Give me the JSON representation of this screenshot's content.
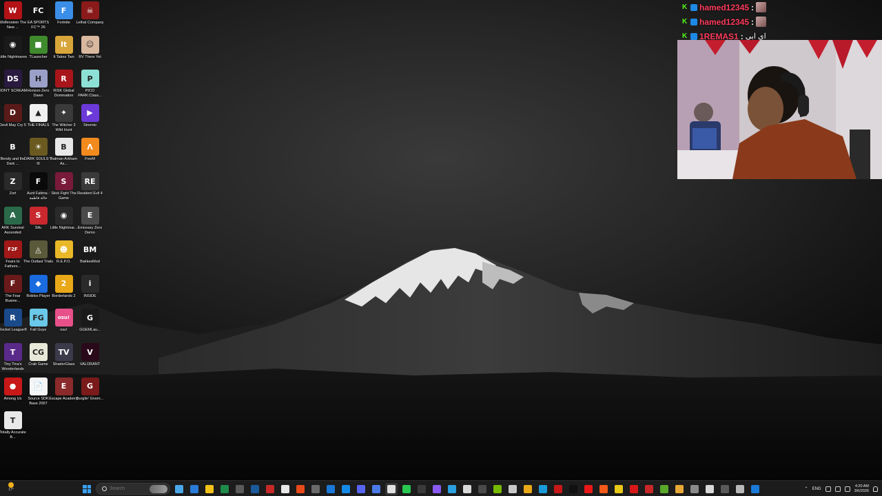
{
  "desktop": {
    "icons": [
      {
        "label": "Wolfenstein The New ...",
        "glyph": "W",
        "color": "#b31217"
      },
      {
        "label": "EA SPORTS FC™ 26",
        "glyph": "FC",
        "color": "#111111"
      },
      {
        "label": "Fortnite",
        "glyph": "F",
        "color": "#3b8ee8"
      },
      {
        "label": "Lethal Company",
        "glyph": "☠",
        "color": "#8b1a1a"
      },
      {
        "label": "Little Nightmares",
        "glyph": "◉",
        "color": "#1a1a1a"
      },
      {
        "label": "TLauncher",
        "glyph": "■",
        "color": "#3f8a2c"
      },
      {
        "label": "It Takes Two",
        "glyph": "It",
        "color": "#d8a53a"
      },
      {
        "label": "RV There Yet",
        "glyph": "☺",
        "color": "#d9b8a0"
      },
      {
        "label": "DON'T SCREAM",
        "glyph": "DS",
        "color": "#2a1a40"
      },
      {
        "label": "Horizon Zero Dawn",
        "glyph": "H",
        "color": "#9aa0c8"
      },
      {
        "label": "RISK Global Domination",
        "glyph": "R",
        "color": "#a8151a"
      },
      {
        "label": "PICO PARK:Class...",
        "glyph": "P",
        "color": "#8de0d6"
      },
      {
        "label": "Devil May Cry 5",
        "glyph": "D",
        "color": "#5a1a1a"
      },
      {
        "label": "THE FINALS",
        "glyph": "▲",
        "color": "#f0f0f0"
      },
      {
        "label": "The Witcher 3 Wild Hunt",
        "glyph": "✦",
        "color": "#3a3a3a"
      },
      {
        "label": "Stremio",
        "glyph": "▶",
        "color": "#6b3ad8"
      },
      {
        "label": "Bendy and the Dark ...",
        "glyph": "B",
        "color": "#1a1a1a"
      },
      {
        "label": "DARK SOULS™ III",
        "glyph": "☀",
        "color": "#6b5a20"
      },
      {
        "label": "Batman Arkham As...",
        "glyph": "B",
        "color": "#e8e8e8"
      },
      {
        "label": "FiveM",
        "glyph": "Λ",
        "color": "#f28a1e"
      },
      {
        "label": "Zort",
        "glyph": "Z",
        "color": "#2a2a2a"
      },
      {
        "label": "Aunt Fatima - خالة فاطمة",
        "glyph": "F",
        "color": "#0a0a0a"
      },
      {
        "label": "Stick Fight The Game",
        "glyph": "S",
        "color": "#7a1a3a"
      },
      {
        "label": "Resident Evil 4",
        "glyph": "RE",
        "color": "#3a3a3a"
      },
      {
        "label": "ARK Survival Ascended",
        "glyph": "A",
        "color": "#2a6a4a"
      },
      {
        "label": "Sifu",
        "glyph": "S",
        "color": "#c8282e"
      },
      {
        "label": "Little Nightmar...",
        "glyph": "◉",
        "color": "#2a2a2a"
      },
      {
        "label": "Emissary Zero Demo",
        "glyph": "E",
        "color": "#4a4a4a"
      },
      {
        "label": "Fears to Fathom...",
        "glyph": "F2F",
        "color": "#a01818"
      },
      {
        "label": "The Outlast Trials",
        "glyph": "◬",
        "color": "#5a5a3a"
      },
      {
        "label": "R.E.P.O.",
        "glyph": "☻",
        "color": "#e8b828"
      },
      {
        "label": "BakkesMod",
        "glyph": "BM",
        "color": "#1a1a1a"
      },
      {
        "label": "The Fear Busine...",
        "glyph": "F",
        "color": "#6a1a1a"
      },
      {
        "label": "Roblox Player",
        "glyph": "◆",
        "color": "#1a6ae0"
      },
      {
        "label": "Borderlands 2",
        "glyph": "2",
        "color": "#e8a818"
      },
      {
        "label": "INSIDE",
        "glyph": "i",
        "color": "#2a2a2a"
      },
      {
        "label": "Rocket League®",
        "glyph": "R",
        "color": "#1a4a8a"
      },
      {
        "label": "Fall Guys",
        "glyph": "FG",
        "color": "#6ac8e8"
      },
      {
        "label": "osu!",
        "glyph": "osu!",
        "color": "#e8508a"
      },
      {
        "label": "GGEMLau...",
        "glyph": "G",
        "color": "#1a1a1a"
      },
      {
        "label": "Tiny Tina's Wonderlands",
        "glyph": "T",
        "color": "#5a2a8a"
      },
      {
        "label": "Crab Game",
        "glyph": "CG",
        "color": "#e8e8d8"
      },
      {
        "label": "ShaderGlass",
        "glyph": "TV",
        "color": "#3a3a4a"
      },
      {
        "label": "VALORANT",
        "glyph": "V",
        "color": "#2a0a1a"
      },
      {
        "label": "Among Us",
        "glyph": "●",
        "color": "#c81818"
      },
      {
        "label": "Source SDK Base 2007",
        "glyph": "📄",
        "color": "#f5f5f5"
      },
      {
        "label": "Escape Academy",
        "glyph": "E",
        "color": "#8a2a2a"
      },
      {
        "label": "Burglin' Gnom...",
        "glyph": "G",
        "color": "#7a1a1a"
      },
      {
        "label": "Totally Accurate B...",
        "glyph": "T",
        "color": "#e8e8e8"
      }
    ]
  },
  "chat": {
    "messages": [
      {
        "user": "hamed12345",
        "separator": ":",
        "text": ""
      },
      {
        "user": "hamed12345",
        "separator": ":",
        "text": ""
      },
      {
        "user": "1REMAS1",
        "separator": ":",
        "text": "اي ابي"
      }
    ]
  },
  "taskbar": {
    "weather_temp": "17°",
    "search_placeholder": "Search",
    "apps": [
      {
        "name": "copilot-app",
        "color": "#4aa8e8"
      },
      {
        "name": "store-app",
        "color": "#2a7ad8"
      },
      {
        "name": "file-explorer-app",
        "color": "#f2c218"
      },
      {
        "name": "excel-app",
        "color": "#1f8a4a"
      },
      {
        "name": "calculator-app",
        "color": "#5a5a5a"
      },
      {
        "name": "steam-app",
        "color": "#1a5a9a"
      },
      {
        "name": "game-app-1",
        "color": "#c82828"
      },
      {
        "name": "steam-big-app",
        "color": "#e8e8e8"
      },
      {
        "name": "ea-app",
        "color": "#e84a1a"
      },
      {
        "name": "photos-app",
        "color": "#6a6a6a"
      },
      {
        "name": "edge-beta-app",
        "color": "#1a78d8"
      },
      {
        "name": "battlenet-app",
        "color": "#148ae8"
      },
      {
        "name": "discord-app",
        "color": "#5865f2"
      },
      {
        "name": "discord-ptb-app",
        "color": "#4a7ae8"
      },
      {
        "name": "gear-app",
        "color": "#e0e0e0"
      },
      {
        "name": "xbox-app",
        "color": "#28c850"
      },
      {
        "name": "obs-app",
        "color": "#3a3a3a"
      },
      {
        "name": "kick-app",
        "color": "#8a5af2"
      },
      {
        "name": "telegram-app",
        "color": "#2aa0e0"
      },
      {
        "name": "steam-app-2",
        "color": "#d8d8d8"
      },
      {
        "name": "vpn-app",
        "color": "#4a4a4a"
      },
      {
        "name": "nvidia-app",
        "color": "#76b900"
      },
      {
        "name": "settings-app",
        "color": "#c8c8c8"
      },
      {
        "name": "chrome-app",
        "color": "#e8a818"
      },
      {
        "name": "edge-app",
        "color": "#1a9ad8"
      },
      {
        "name": "capture-app",
        "color": "#c81818"
      },
      {
        "name": "tiktok-app",
        "color": "#111111"
      },
      {
        "name": "adobe-app",
        "color": "#e81818"
      },
      {
        "name": "brave-app",
        "color": "#f25a1a"
      },
      {
        "name": "game-app-2",
        "color": "#e8c818"
      },
      {
        "name": "game-app-3",
        "color": "#d81818"
      },
      {
        "name": "game-app-4",
        "color": "#c82828"
      },
      {
        "name": "minecraft-app",
        "color": "#5aa82a"
      },
      {
        "name": "game-app-5",
        "color": "#e8a838"
      },
      {
        "name": "tool-app",
        "color": "#8a8a8a"
      },
      {
        "name": "home-app",
        "color": "#d8d8d8"
      },
      {
        "name": "terminal-app",
        "color": "#5a5a5a"
      },
      {
        "name": "notes-app",
        "color": "#b8b8b8"
      },
      {
        "name": "vscode-app",
        "color": "#1a7ad8"
      }
    ],
    "language": "ENG",
    "time": "4:20 AM",
    "date": "3/6/2026"
  }
}
